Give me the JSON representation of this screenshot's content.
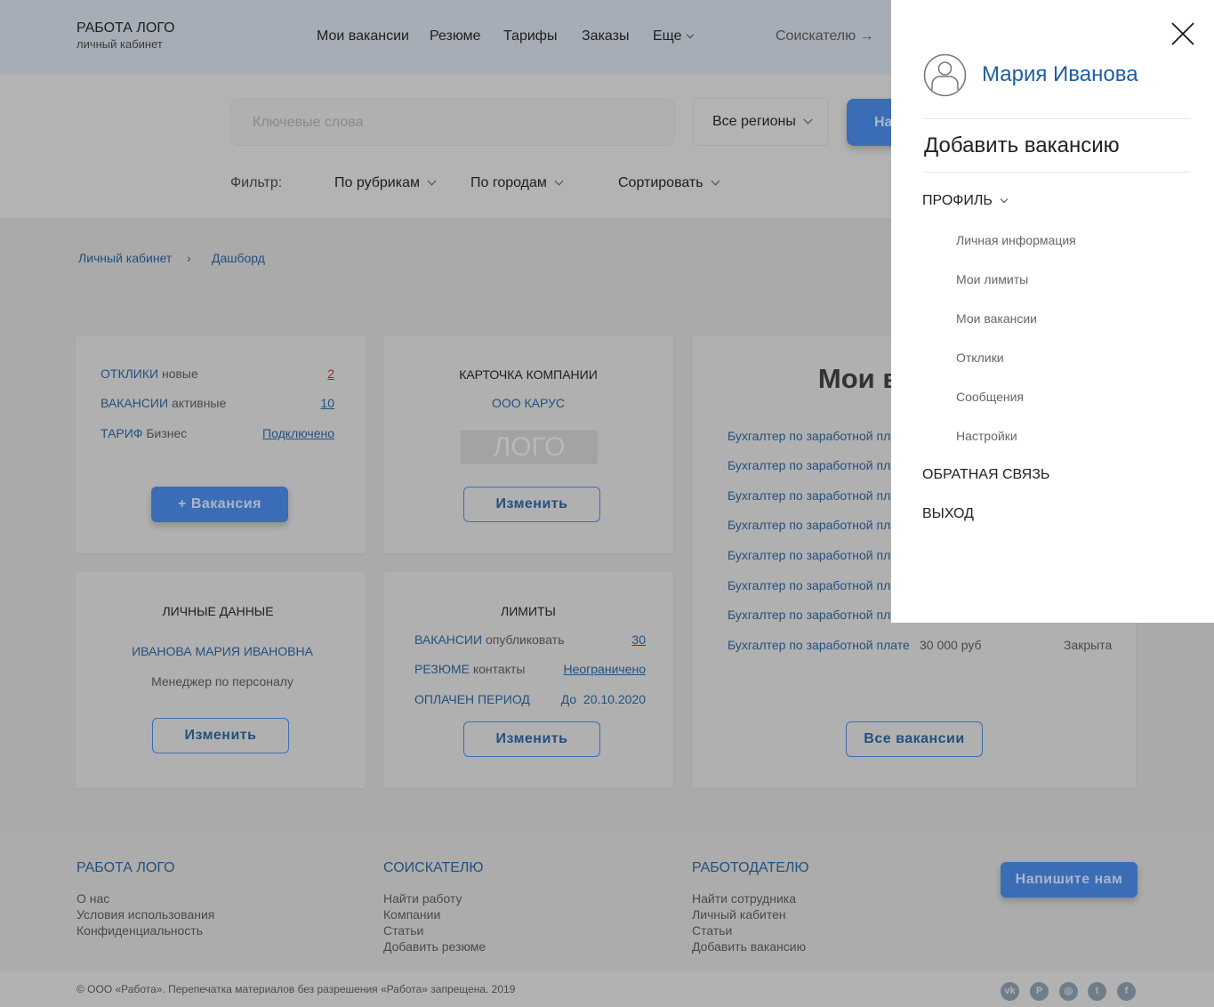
{
  "header": {
    "logo_title": "РАБОТА ЛОГО",
    "logo_subtitle": "личный кабинет",
    "nav": [
      "Мои вакансии",
      "Резюме",
      "Тарифы",
      "Заказы",
      "Еще"
    ],
    "seeker_link": "Соискателю →"
  },
  "search": {
    "keywords_placeholder": "Ключевые слова",
    "region": "Все регионы",
    "find_button": "На",
    "filter_label": "Фильтр:",
    "filters": [
      "По рубрикам",
      "По городам",
      "Сортировать"
    ]
  },
  "breadcrumb": [
    "Личный кабинет",
    "Дашборд"
  ],
  "stats_card": {
    "rows": [
      {
        "key": "ОТКЛИКИ",
        "sub": "новые",
        "value": "2",
        "value_color": "#b0223a"
      },
      {
        "key": "ВАКАНСИИ",
        "sub": "активные",
        "value": "10"
      },
      {
        "key": "ТАРИФ",
        "sub": "Бизнес",
        "value": "Подключено"
      }
    ],
    "button": "+ Вакансия"
  },
  "company_card": {
    "title": "КАРТОЧКА КОМПАНИИ",
    "name": "ООО КАРУС",
    "logo": "ЛОГО",
    "button": "Изменить"
  },
  "personal_card": {
    "title": "ЛИЧНЫЕ ДАННЫЕ",
    "name": "ИВАНОВА МАРИЯ ИВАНОВНА",
    "role": "Менеджер по персоналу",
    "button": "Изменить"
  },
  "limits_card": {
    "title": "ЛИМИТЫ",
    "rows": [
      {
        "key": "ВАКАНСИИ",
        "sub": "опубликовать",
        "value": "30"
      },
      {
        "key": "РЕЗЮМЕ",
        "sub": "контакты",
        "value": "Неограничено"
      },
      {
        "key": "ОПЛАЧЕН ПЕРИОД",
        "sub": "",
        "value": "До  20.10.2020"
      }
    ],
    "button": "Изменить"
  },
  "vacancies_card": {
    "title": "Мои вакансии",
    "rows": [
      {
        "title": "Бухгалтер по заработной плате"
      },
      {
        "title": "Бухгалтер по заработной плате"
      },
      {
        "title": "Бухгалтер по заработной плате"
      },
      {
        "title": "Бухгалтер по заработной плате"
      },
      {
        "title": "Бухгалтер по заработной плате"
      },
      {
        "title": "Бухгалтер по заработной плате"
      },
      {
        "title": "Бухгалтер по заработной плате"
      },
      {
        "title": "Бухгалтер по заработной плате",
        "salary": "30 000 руб",
        "status": "Закрыта"
      }
    ],
    "button": "Все вакансии"
  },
  "footer": {
    "cols": [
      {
        "title": "РАБОТА ЛОГО",
        "links": [
          "О нас",
          "Условия использования",
          "Конфиденциальность"
        ]
      },
      {
        "title": "СОИСКАТЕЛЮ",
        "links": [
          "Найти работу",
          "Компании",
          "Статьи",
          "Добавить резюме"
        ]
      },
      {
        "title": "РАБОТОДАТЕЛЮ",
        "links": [
          "Найти сотрудника",
          "Личный кабитен",
          "Статьи",
          "Добавить вакансию"
        ]
      }
    ],
    "contact_button": "Напишите нам",
    "copyright": "© ООО «Работа». Перепечатка материалов без разрешения «Работа» запрещена. 2019",
    "social": [
      "vk-icon",
      "pinterest-icon",
      "instagram-icon",
      "twitter-icon",
      "facebook-icon"
    ]
  },
  "drawer": {
    "user_name": "Мария Иванова",
    "add_vacancy": "Добавить вакансию",
    "profile": "ПРОФИЛЬ",
    "profile_items": [
      "Личная информация",
      "Мои лимиты",
      "Мои вакансии",
      "Отклики",
      "Сообщения",
      "Настройки"
    ],
    "feedback": "ОБРАТНАЯ СВЯЗЬ",
    "logout": "ВЫХОД"
  },
  "colors": {
    "accent": "#3a6db5",
    "link": "#23507f",
    "drawer_name": "#1f5fa0"
  }
}
